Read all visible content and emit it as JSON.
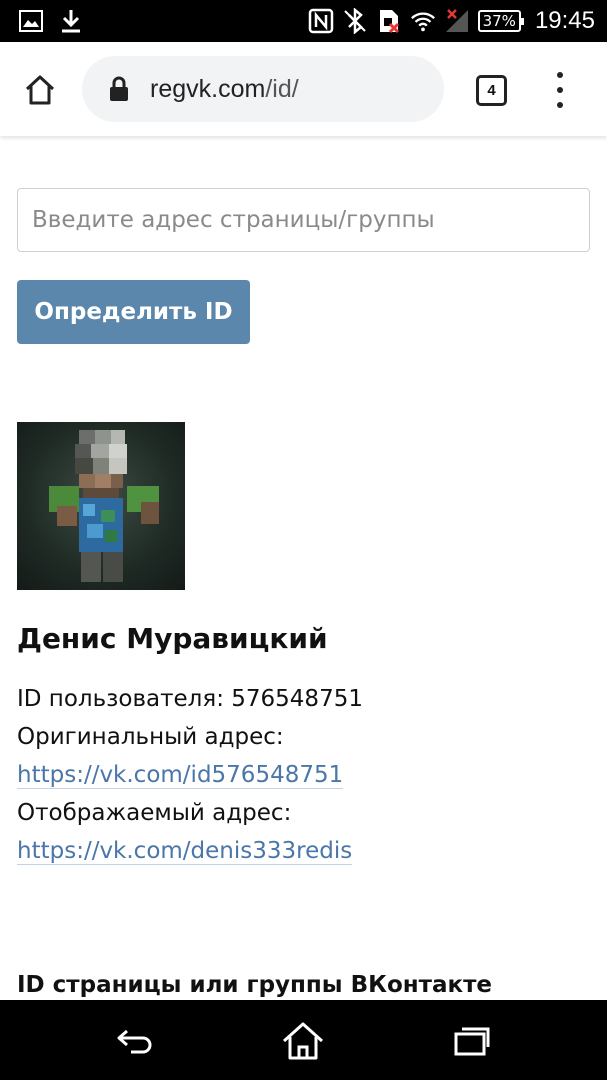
{
  "status_bar": {
    "icons_left": [
      "gallery-icon",
      "download-icon"
    ],
    "icons_right": [
      "nfc-icon",
      "bluetooth-icon",
      "sim-icon",
      "wifi-icon",
      "signal-icon"
    ],
    "battery": "37%",
    "time": "19:45"
  },
  "browser": {
    "url_domain": "regvk.com",
    "url_path": "/id/",
    "tab_count": "4"
  },
  "form": {
    "placeholder": "Введите адрес страницы/группы",
    "button_label": "Определить ID"
  },
  "profile": {
    "name": "Денис Муравицкий",
    "id_line": "ID пользователя: 576548751",
    "original_label": "Оригинальный адрес:",
    "original_link": "https://vk.com/id576548751",
    "display_label": "Отображаемый адрес:",
    "display_link": "https://vk.com/denis333redis"
  },
  "section": {
    "title": "ID страницы или группы ВКонтакте"
  },
  "colors": {
    "button": "#5b87ad",
    "link": "#4a76a8"
  }
}
